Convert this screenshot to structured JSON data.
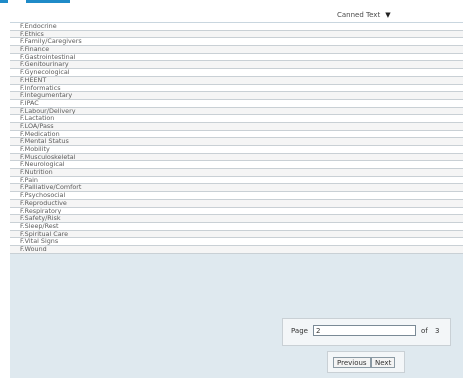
{
  "grid": {
    "header": "Canned Text",
    "sort_icon": "caret-down-icon",
    "rows": [
      "F.Endocrine",
      "F.Ethics",
      "F.Family/Caregivers",
      "F.Finance",
      "F.Gastrointestinal",
      "F.Genitourinary",
      "F.Gynecological",
      "F.HEENT",
      "F.Informatics",
      "F.Integumentary",
      "F.IPAC",
      "F.Labour/Delivery",
      "F.Lactation",
      "F.LOA/Pass",
      "F.Medication",
      "F.Mental Status",
      "F.Mobility",
      "F.Musculoskeletal",
      "F.Neurological",
      "F.Nutrition",
      "F.Pain",
      "F.Palliative/Comfort",
      "F.Psychosocial",
      "F.Reproductive",
      "F.Respiratory",
      "F.Safety/Risk",
      "F.Sleep/Rest",
      "F.Spiritual Care",
      "F.Vital Signs",
      "F.Wound"
    ]
  },
  "pager": {
    "page_label": "Page",
    "page_value": "2",
    "of_label": "of",
    "total_pages": "3",
    "previous_label": "Previous",
    "next_label": "Next"
  },
  "colors": {
    "accent": "#1f8bc8",
    "panel_bg": "#dfe9ef"
  }
}
